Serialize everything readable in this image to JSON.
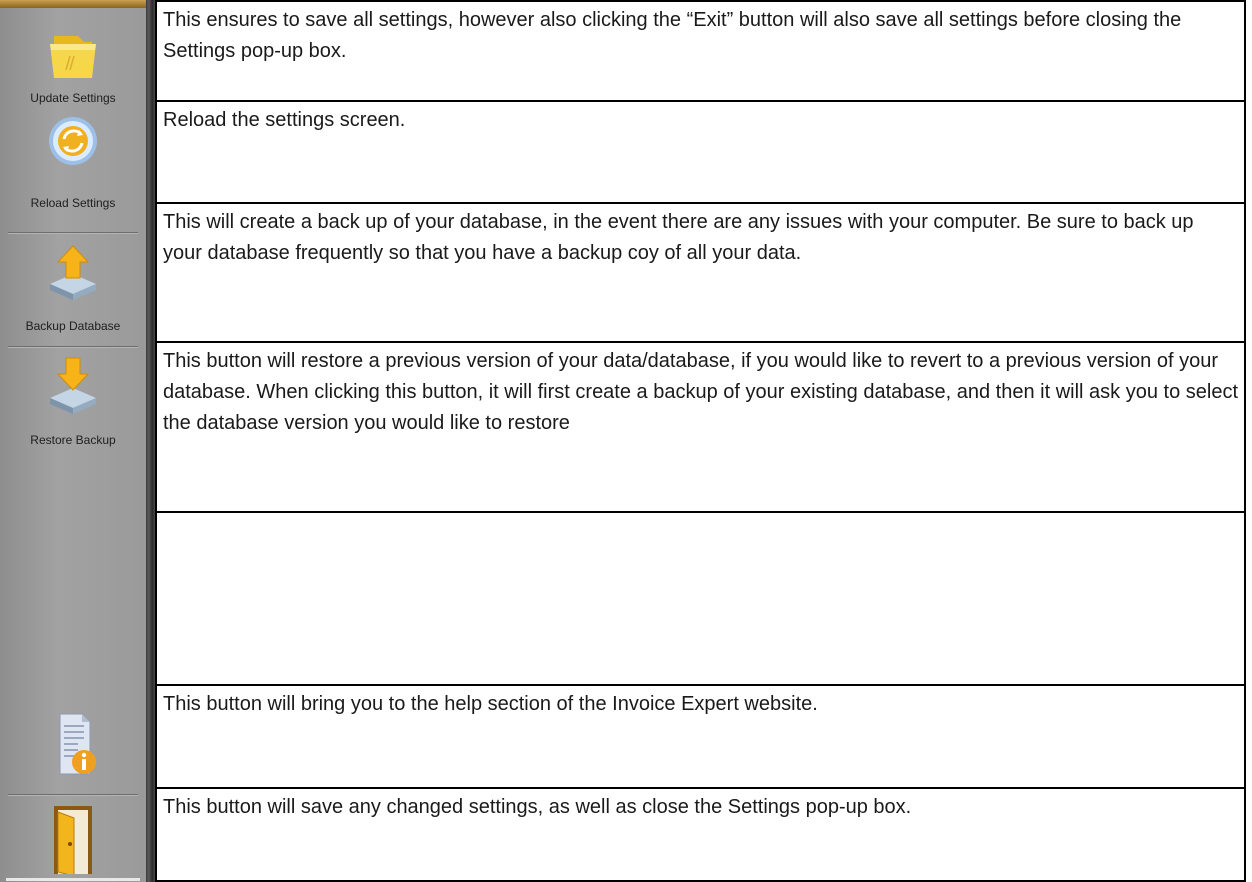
{
  "toolbar": {
    "items": [
      {
        "label": "Update Settings",
        "icon": "folder-icon"
      },
      {
        "label": "Reload Settings",
        "icon": "refresh-icon"
      },
      {
        "label": "Backup Database",
        "icon": "backup-upload-icon"
      },
      {
        "label": "Restore Backup",
        "icon": "restore-download-icon"
      },
      {
        "label": "",
        "icon": "help-info-icon"
      },
      {
        "label": "",
        "icon": "exit-door-icon"
      }
    ]
  },
  "descriptions": [
    "This ensures to save all settings, however also clicking the “Exit” button will also save all settings before closing the Settings pop-up box.",
    "Reload the settings screen.",
    "This will create a back up of your database, in the event there are any issues with your computer.  Be sure to back up your database frequently so that you have a backup coy of all your data.",
    "This button will restore a previous version of your data/database, if you would like to revert to a previous version of your database.  When clicking this button, it will first create a backup of your existing database, and then it will ask you to select the database version you would like to restore",
    "",
    "This button will bring you to the help section of the Invoice Expert website.",
    "This button will save any changed settings, as well as close the Settings pop-up box."
  ]
}
